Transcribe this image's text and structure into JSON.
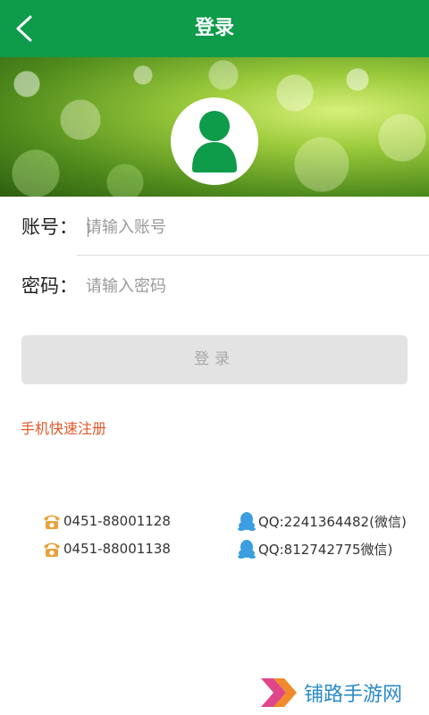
{
  "header": {
    "title": "登录",
    "accent_color": "#0e9b4a",
    "back_icon": "chevron-left-icon"
  },
  "banner": {
    "avatar_icon": "user-avatar-icon",
    "avatar_color": "#0e9b4a"
  },
  "form": {
    "account_label": "账号：",
    "account_placeholder": "请输入账号",
    "password_label": "密码：",
    "password_placeholder": "请输入密码",
    "login_button": "登录"
  },
  "register_link": "手机快速注册",
  "register_color": "#e2582a",
  "contacts": {
    "phone_icon": "phone-icon",
    "phone_color": "#e8a23b",
    "phones": [
      "0451-88001128",
      "0451-88001138"
    ],
    "qq_icon": "qq-penguin-icon",
    "qq_color": "#3a9ee0",
    "qq": [
      "QQ:2241364482(微信)",
      "QQ:812742775微信)"
    ]
  },
  "watermark": {
    "text": "铺路手游网",
    "icon": "double-chevron-logo-icon"
  }
}
